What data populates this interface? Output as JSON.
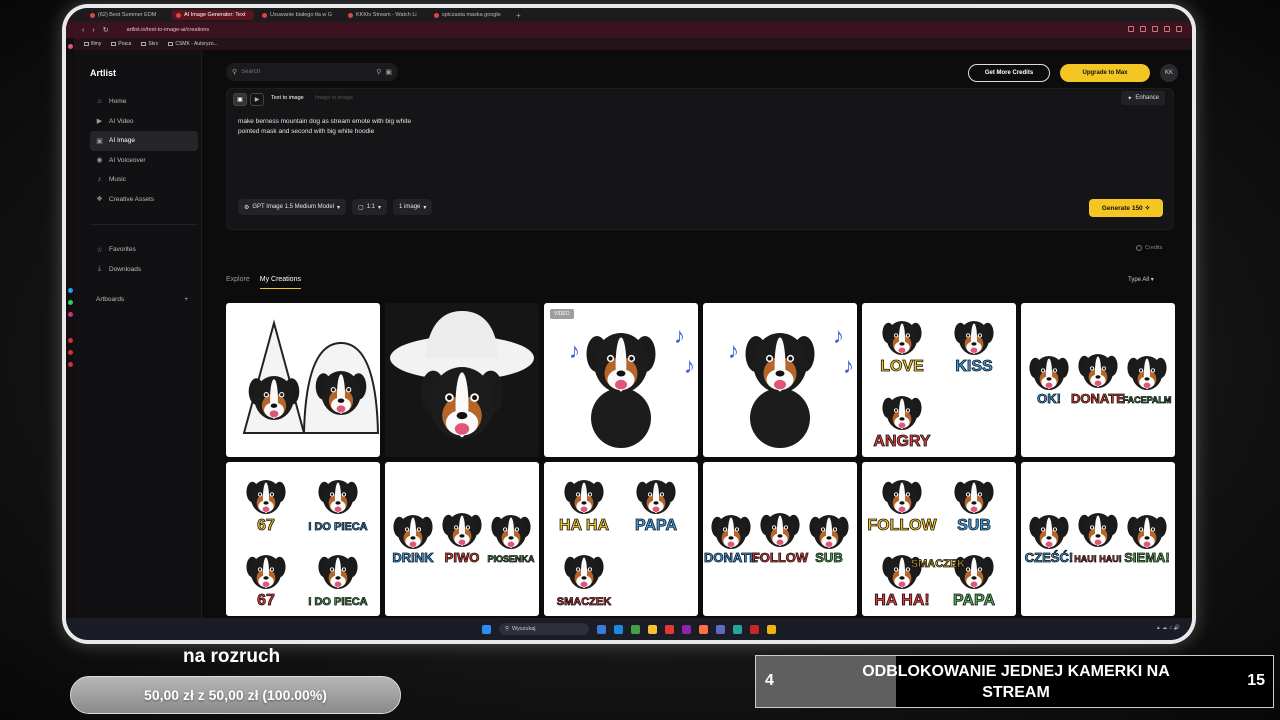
{
  "browser": {
    "tabs": [
      {
        "title": "(62) Best Summer EDM"
      },
      {
        "title": "AI Image Generator: Text"
      },
      {
        "title": "Usuwanie białego tła w G"
      },
      {
        "title": "KKKtv Stream - Watch Li"
      },
      {
        "title": "spiczasta maska google"
      }
    ],
    "url": "artlist.io/text-to-image-ai/creations",
    "bookmarks": [
      "filmy",
      "Praca",
      "Skrv",
      "CSMK - Autoryzo..."
    ]
  },
  "app": {
    "logo": "Artlist",
    "nav": [
      {
        "label": "Home",
        "icon": "home-icon"
      },
      {
        "label": "AI Video",
        "icon": "video-icon"
      },
      {
        "label": "AI Image",
        "icon": "image-icon"
      },
      {
        "label": "AI Voiceover",
        "icon": "voice-icon"
      },
      {
        "label": "Music",
        "icon": "music-icon"
      },
      {
        "label": "Creative Assets",
        "icon": "assets-icon"
      }
    ],
    "nav2": [
      {
        "label": "Favorites",
        "icon": "star-icon"
      },
      {
        "label": "Downloads",
        "icon": "download-icon"
      }
    ],
    "artboards": "Artboards",
    "search_placeholder": "Search",
    "get_credits": "Get More Credits",
    "upgrade": "Upgrade to Max",
    "avatar": "KK",
    "prompt": {
      "tab_active": "Text to image",
      "tab_other": "Image to image",
      "enhance": "Enhance",
      "text_line1": "make berness mountain dog as stream emote with big white",
      "text_line2": "pointed mask and second with big white hoodie",
      "model": "GPT Image 1.5 Medium Model",
      "ratio": "1:1",
      "count": "1 image",
      "generate": "Generate 150"
    },
    "credits": "Credits",
    "tabs": [
      "Explore",
      "My Creations"
    ],
    "type_filter": "Type",
    "type_value": "All",
    "cards": [
      {
        "kind": "masks",
        "dark": false,
        "badge": "",
        "labels": []
      },
      {
        "kind": "cowboy",
        "dark": true,
        "badge": "",
        "labels": []
      },
      {
        "kind": "dance",
        "dark": false,
        "badge": "VIDEO",
        "labels": []
      },
      {
        "kind": "dance",
        "dark": false,
        "badge": "",
        "labels": []
      },
      {
        "kind": "text4",
        "dark": false,
        "badge": "",
        "labels": [
          "LOVE",
          "KISS",
          "ANGRY"
        ]
      },
      {
        "kind": "text3",
        "dark": false,
        "badge": "",
        "labels": [
          "OK!",
          "DONATE",
          "FACEPALM"
        ]
      },
      {
        "kind": "text4",
        "dark": false,
        "badge": "",
        "labels": [
          "67",
          "I DO PIECA",
          "67",
          "I DO PIECA"
        ]
      },
      {
        "kind": "text3",
        "dark": false,
        "badge": "",
        "labels": [
          "DRINK",
          "PIWO",
          "PIOSENKA"
        ]
      },
      {
        "kind": "text4",
        "dark": false,
        "badge": "",
        "labels": [
          "HA HA",
          "PAPA",
          "SMACZEK"
        ]
      },
      {
        "kind": "text3",
        "dark": false,
        "badge": "",
        "labels": [
          "DONATE",
          "FOLLOW",
          "SUB"
        ]
      },
      {
        "kind": "text4",
        "dark": false,
        "badge": "",
        "labels": [
          "FOLLOW",
          "SUB",
          "HA HA!",
          "PAPA",
          "SMACZEK"
        ]
      },
      {
        "kind": "text3",
        "dark": false,
        "badge": "",
        "labels": [
          "CZEŚĆ!",
          "HAU! HAU!",
          "SIEMA!"
        ]
      }
    ]
  },
  "taskbar": {
    "search": "Wyszukaj"
  },
  "overlay": {
    "donation_label": "na rozruch",
    "donation_progress": "50,00 zł z 50,00 zł (100.00%)",
    "donation_fraction": 1.0,
    "goal_left": "4",
    "goal_title": "ODBLOKOWANIE JEDNEJ KAMERKI NA STREAM",
    "goal_right": "15",
    "goal_fraction": 0.27
  },
  "colors": {
    "accent": "#f3c623",
    "background": "#0c0c0d"
  }
}
